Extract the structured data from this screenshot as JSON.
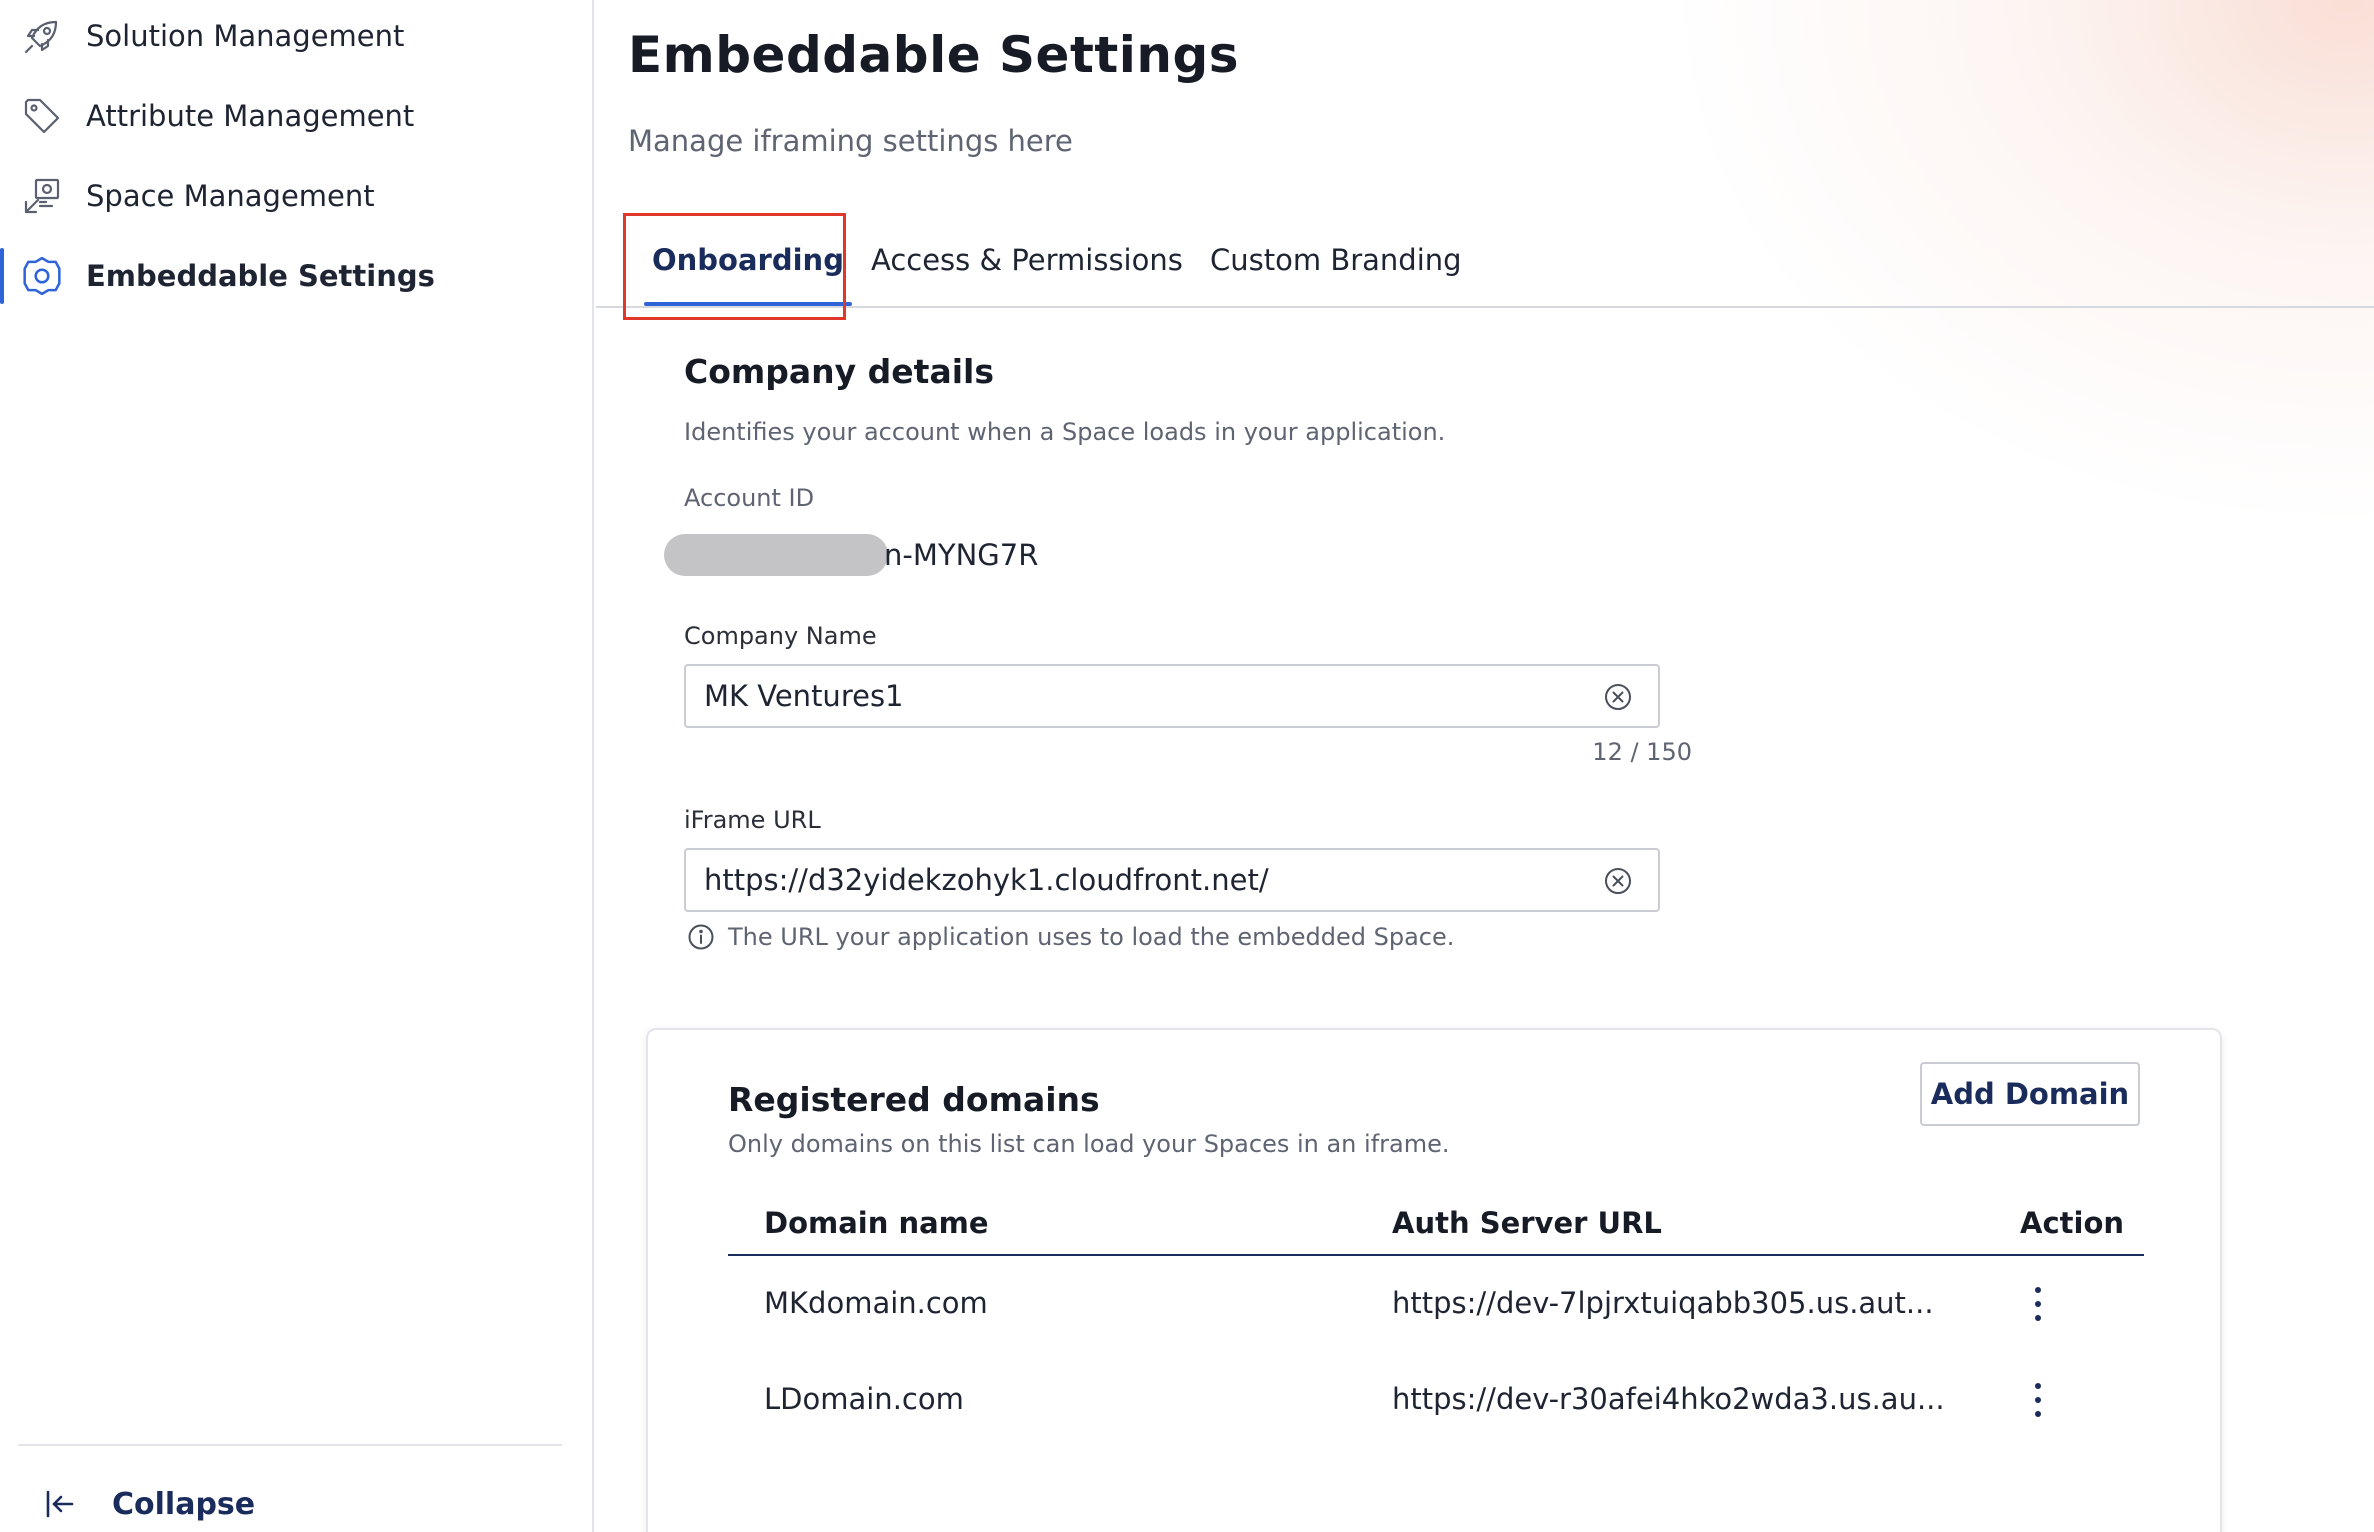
{
  "sidebar": {
    "items": [
      {
        "label": "Solution Management",
        "icon": "rocket-icon",
        "active": false
      },
      {
        "label": "Attribute Management",
        "icon": "tag-icon",
        "active": false
      },
      {
        "label": "Space Management",
        "icon": "space-icon",
        "active": false
      },
      {
        "label": "Embeddable Settings",
        "icon": "gear-icon",
        "active": true
      }
    ],
    "collapse_label": "Collapse"
  },
  "header": {
    "title": "Embeddable Settings",
    "subtitle": "Manage iframing settings here"
  },
  "tabs": [
    {
      "label": "Onboarding",
      "active": true
    },
    {
      "label": "Access & Permissions",
      "active": false
    },
    {
      "label": "Custom Branding",
      "active": false
    }
  ],
  "company": {
    "title": "Company details",
    "description": "Identifies your account when a Space loads in your application.",
    "account_id_label": "Account ID",
    "account_id_suffix": "n-MYNG7R",
    "company_name_label": "Company Name",
    "company_name_value": "MK Ventures1",
    "company_name_count": "12 / 150",
    "iframe_url_label": "iFrame URL",
    "iframe_url_value": "https://d32yidekzohyk1.cloudfront.net/",
    "iframe_url_helper": "The URL your application uses to load the embedded Space."
  },
  "domains": {
    "title": "Registered domains",
    "description": "Only domains on this list can load your Spaces in an iframe.",
    "add_button_label": "Add Domain",
    "columns": [
      "Domain name",
      "Auth Server URL",
      "Action"
    ],
    "rows": [
      {
        "domain": "MKdomain.com",
        "auth_url": "https://dev-7lpjrxtuiqabb305.us.aut..."
      },
      {
        "domain": "LDomain.com",
        "auth_url": "https://dev-r30afei4hko2wda3.us.au..."
      }
    ]
  },
  "colors": {
    "accent": "#2f64d9",
    "navy": "#1a2c5c",
    "highlight": "#e0372b"
  }
}
